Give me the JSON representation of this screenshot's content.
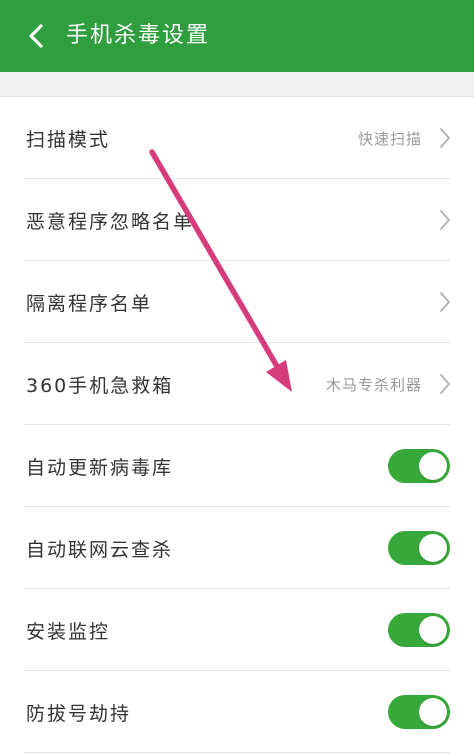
{
  "header": {
    "title": "手机杀毒设置",
    "back_icon": "chevron-left-icon",
    "background": "#2e9e3f"
  },
  "settings": {
    "nav_rows": [
      {
        "label": "扫描模式",
        "value": "快速扫描"
      },
      {
        "label": "恶意程序忽略名单",
        "value": ""
      },
      {
        "label": "隔离程序名单",
        "value": ""
      },
      {
        "label": "360手机急救箱",
        "value": "木马专杀利器"
      }
    ],
    "toggle_rows": [
      {
        "label": "自动更新病毒库",
        "enabled": true
      },
      {
        "label": "自动联网云查杀",
        "enabled": true
      },
      {
        "label": "安装监控",
        "enabled": true
      },
      {
        "label": "防拔号劫持",
        "enabled": true
      }
    ],
    "toggle_color": "#37a83a",
    "chevron_icon": "chevron-right-icon"
  },
  "annotation": {
    "arrow_color": "#d63b7e",
    "icon": "annotation-arrow"
  }
}
